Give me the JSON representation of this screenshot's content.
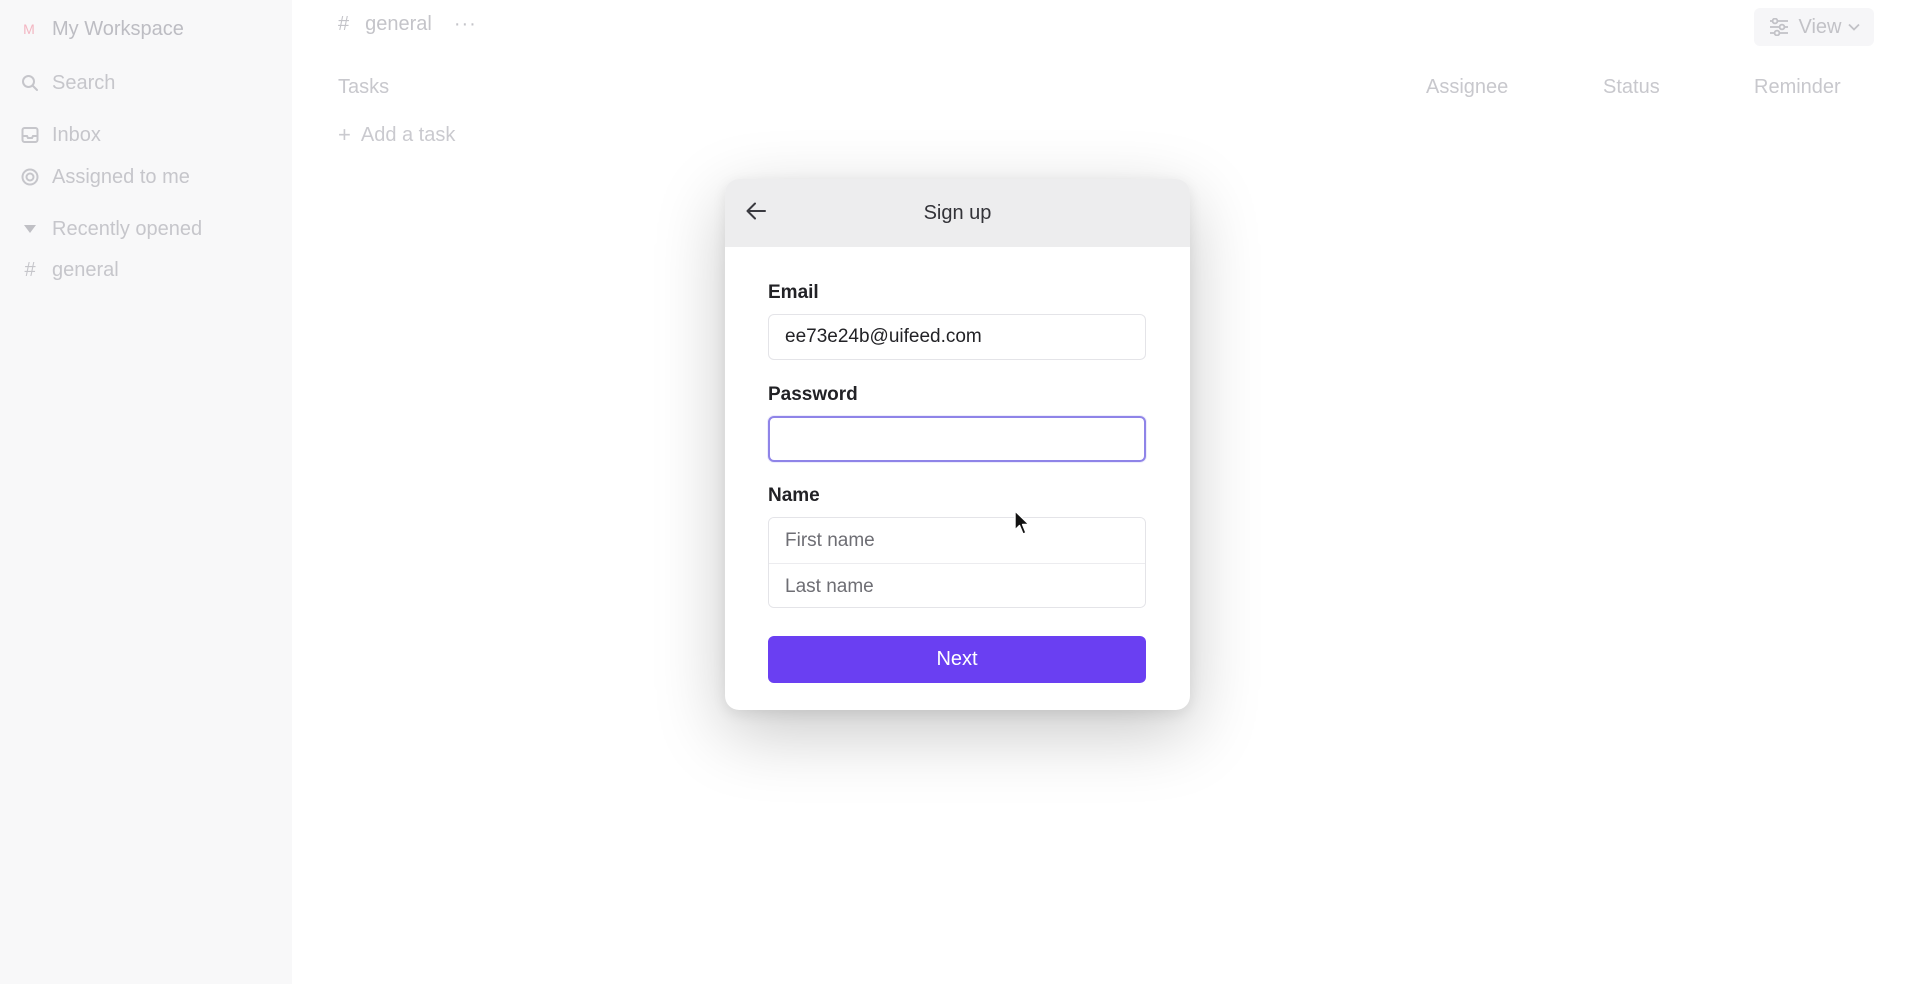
{
  "sidebar": {
    "workspace": {
      "avatar_letter": "M",
      "name": "My Workspace"
    },
    "search_label": "Search",
    "inbox_label": "Inbox",
    "assigned_label": "Assigned to me",
    "recently_opened_label": "Recently opened",
    "channel_label": "general"
  },
  "main": {
    "channel_name": "general",
    "more_label": "···",
    "view_label": "View",
    "columns": {
      "tasks": "Tasks",
      "assignee": "Assignee",
      "status": "Status",
      "reminder": "Reminder"
    },
    "add_task_label": "Add a task"
  },
  "modal": {
    "title": "Sign up",
    "email_label": "Email",
    "email_value": "ee73e24b@uifeed.com",
    "password_label": "Password",
    "password_value": "",
    "name_label": "Name",
    "first_name_placeholder": "First name",
    "last_name_placeholder": "Last name",
    "next_label": "Next"
  },
  "colors": {
    "accent": "#6a3ff2",
    "focus_ring": "#8f84e8",
    "header_bg": "#ededee",
    "sidebar_bg": "#f8f8f9"
  },
  "icons": {
    "back": "arrow-left-icon",
    "search": "search-icon",
    "inbox": "inbox-icon",
    "assigned": "target-icon",
    "recent": "caret-down-icon",
    "channel": "hash-icon",
    "view": "sliders-icon"
  }
}
